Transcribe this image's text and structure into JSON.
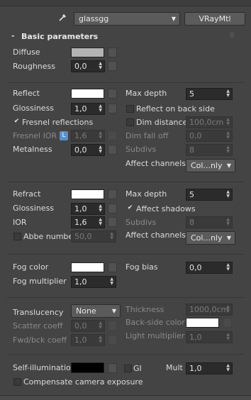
{
  "toolbar": {
    "eyedropper_icon": "eyedropper-icon",
    "material_name": "glassgg",
    "material_type": "VRayMtl"
  },
  "panel": {
    "title": "Basic parameters",
    "collapse_glyph": "-"
  },
  "diffuse": {
    "label": "Diffuse",
    "color": "#b4b4b4",
    "roughness_label": "Roughness",
    "roughness": "0,0"
  },
  "reflect": {
    "label": "Reflect",
    "color": "#ffffff",
    "glossiness_label": "Glossiness",
    "glossiness": "1,0",
    "fresnel_label": "Fresnel reflections",
    "fresnel_ior_label": "Fresnel IOR",
    "fresnel_lock": "L",
    "fresnel_ior": "1,6",
    "metalness_label": "Metalness",
    "metalness": "0,0",
    "max_depth_label": "Max depth",
    "max_depth": "5",
    "reflect_backside_label": "Reflect on back side",
    "dim_distance_label": "Dim distance",
    "dim_distance": "100,0cm",
    "dim_falloff_label": "Dim fall off",
    "dim_falloff": "0,0",
    "subdivs_label": "Subdivs",
    "subdivs": "8",
    "affect_channels_label": "Affect channels",
    "affect_channels": "Col...nly"
  },
  "refract": {
    "label": "Refract",
    "color": "#ffffff",
    "glossiness_label": "Glossiness",
    "glossiness": "1,0",
    "ior_label": "IOR",
    "ior": "1,6",
    "abbe_label": "Abbe number",
    "abbe": "50,0",
    "max_depth_label": "Max depth",
    "max_depth": "5",
    "affect_shadows_label": "Affect shadows",
    "subdivs_label": "Subdivs",
    "subdivs": "8",
    "affect_channels_label": "Affect channels",
    "affect_channels": "Col...nly"
  },
  "fog": {
    "color_label": "Fog color",
    "color": "#ffffff",
    "multiplier_label": "Fog multiplier",
    "multiplier": "1,0",
    "bias_label": "Fog bias",
    "bias": "0,0"
  },
  "translucency": {
    "label": "Translucency",
    "mode": "None",
    "scatter_label": "Scatter coeff",
    "scatter": "0,0",
    "fwd_bck_label": "Fwd/bck coeff",
    "fwd_bck": "1,0",
    "thickness_label": "Thickness",
    "thickness": "1000,0cm",
    "backside_color_label": "Back-side color",
    "backside_color": "#ffffff",
    "light_multiplier_label": "Light multiplier",
    "light_multiplier": "1,0"
  },
  "self_illum": {
    "label": "Self-illumination",
    "color": "#000000",
    "gi_label": "GI",
    "mult_label": "Mult",
    "mult": "1,0",
    "compensate_label": "Compensate camera exposure"
  }
}
